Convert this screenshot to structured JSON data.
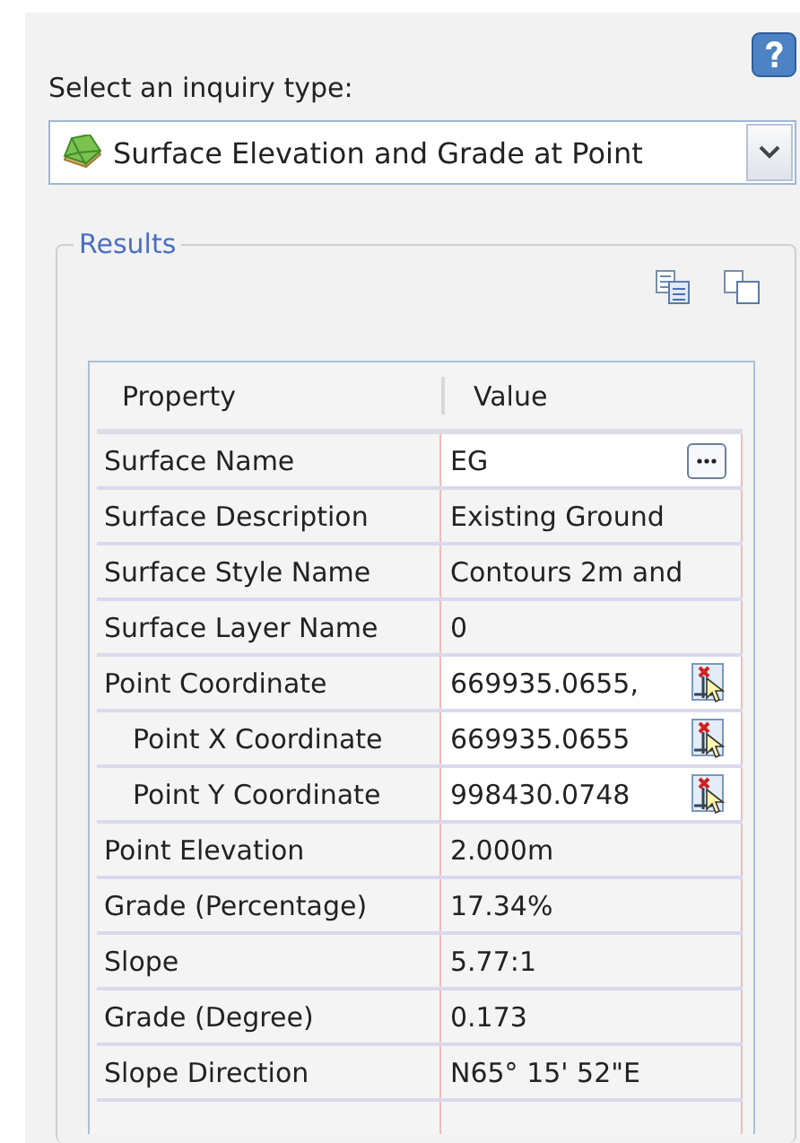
{
  "help": {
    "label": "Select an inquiry type:"
  },
  "inquiry": {
    "value": "Surface Elevation and Grade at Point"
  },
  "results": {
    "title": "Results",
    "table": {
      "columns": [
        "Property",
        "Value"
      ],
      "rows": [
        {
          "property": "Surface Name",
          "value": "EG",
          "kind": "ellipsis"
        },
        {
          "property": "Surface Description",
          "value": "Existing Ground",
          "kind": "text"
        },
        {
          "property": "Surface Style Name",
          "value": "Contours 2m and",
          "kind": "text"
        },
        {
          "property": "Surface Layer Name",
          "value": "0",
          "kind": "text"
        },
        {
          "property": "Point Coordinate",
          "value": "669935.0655,",
          "kind": "pick",
          "children": [
            {
              "property": "Point X Coordinate",
              "value": "669935.0655",
              "kind": "pick"
            },
            {
              "property": "Point Y Coordinate",
              "value": "998430.0748",
              "kind": "pick"
            }
          ]
        },
        {
          "property": "Point Elevation",
          "value": "2.000m",
          "kind": "text"
        },
        {
          "property": "Grade (Percentage)",
          "value": "17.34%",
          "kind": "text"
        },
        {
          "property": "Slope",
          "value": "5.77:1",
          "kind": "text"
        },
        {
          "property": "Grade (Degree)",
          "value": "0.173",
          "kind": "text"
        },
        {
          "property": "Slope Direction",
          "value": "N65° 15' 52\"E",
          "kind": "text"
        }
      ]
    }
  }
}
